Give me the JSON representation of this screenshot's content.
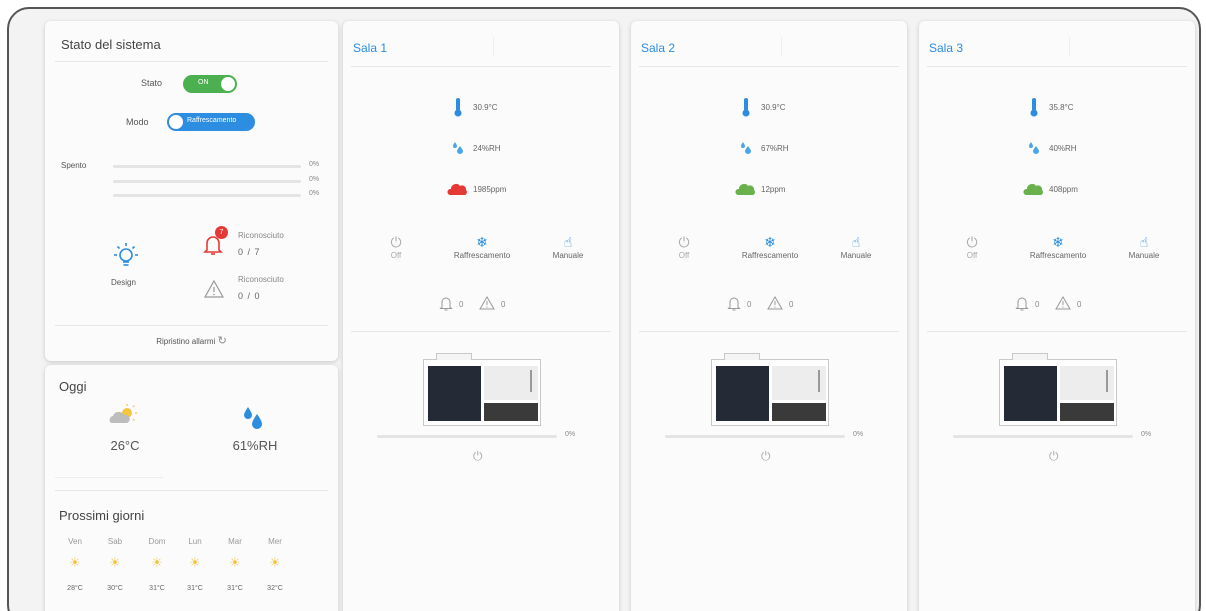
{
  "system": {
    "title": "Stato del sistema",
    "stato_label": "Stato",
    "stato_value": "ON",
    "modo_label": "Modo",
    "modo_value": "Raffrescamento",
    "spento_label": "Spento",
    "bars": [
      {
        "pct": "0%",
        "level": 0
      },
      {
        "pct": "0%",
        "level": 0
      },
      {
        "pct": "0%",
        "level": 0
      }
    ],
    "design_label": "Design",
    "alarm_badge": "7",
    "alarm1_label": "Riconosciuto",
    "alarm1_value": "0 / 7",
    "alarm2_label": "Riconosciuto",
    "alarm2_value": "0 / 0",
    "reset_label": "Ripristino allarmi",
    "accent": "#2d8de0",
    "on_color": "#4caf50"
  },
  "weather": {
    "today_title": "Oggi",
    "temp": "26°C",
    "humidity": "61%RH",
    "next_title": "Prossimi giorni",
    "days": [
      {
        "day": "Ven",
        "temp": "28°C"
      },
      {
        "day": "Sab",
        "temp": "30°C"
      },
      {
        "day": "Dom",
        "temp": "31°C"
      },
      {
        "day": "Lun",
        "temp": "31°C"
      },
      {
        "day": "Mar",
        "temp": "31°C"
      },
      {
        "day": "Mer",
        "temp": "32°C"
      }
    ]
  },
  "rooms": [
    {
      "name": "Sala 1",
      "temp": "30.9°C",
      "hum": "24%RH",
      "co2": "1985ppm",
      "co2_color": "#e53935",
      "mode_off": "Off",
      "mode_cool": "Raffrescamento",
      "mode_manual": "Manuale",
      "alarms": "0",
      "warnings": "0",
      "pct": "0%",
      "level": 0
    },
    {
      "name": "Sala 2",
      "temp": "30.9°C",
      "hum": "67%RH",
      "co2": "12ppm",
      "co2_color": "#6ab04c",
      "mode_off": "Off",
      "mode_cool": "Raffrescamento",
      "mode_manual": "Manuale",
      "alarms": "0",
      "warnings": "0",
      "pct": "0%",
      "level": 0
    },
    {
      "name": "Sala 3",
      "temp": "35.8°C",
      "hum": "40%RH",
      "co2": "408ppm",
      "co2_color": "#6ab04c",
      "mode_off": "Off",
      "mode_cool": "Raffrescamento",
      "mode_manual": "Manuale",
      "alarms": "0",
      "warnings": "0",
      "pct": "0%",
      "level": 0
    }
  ]
}
